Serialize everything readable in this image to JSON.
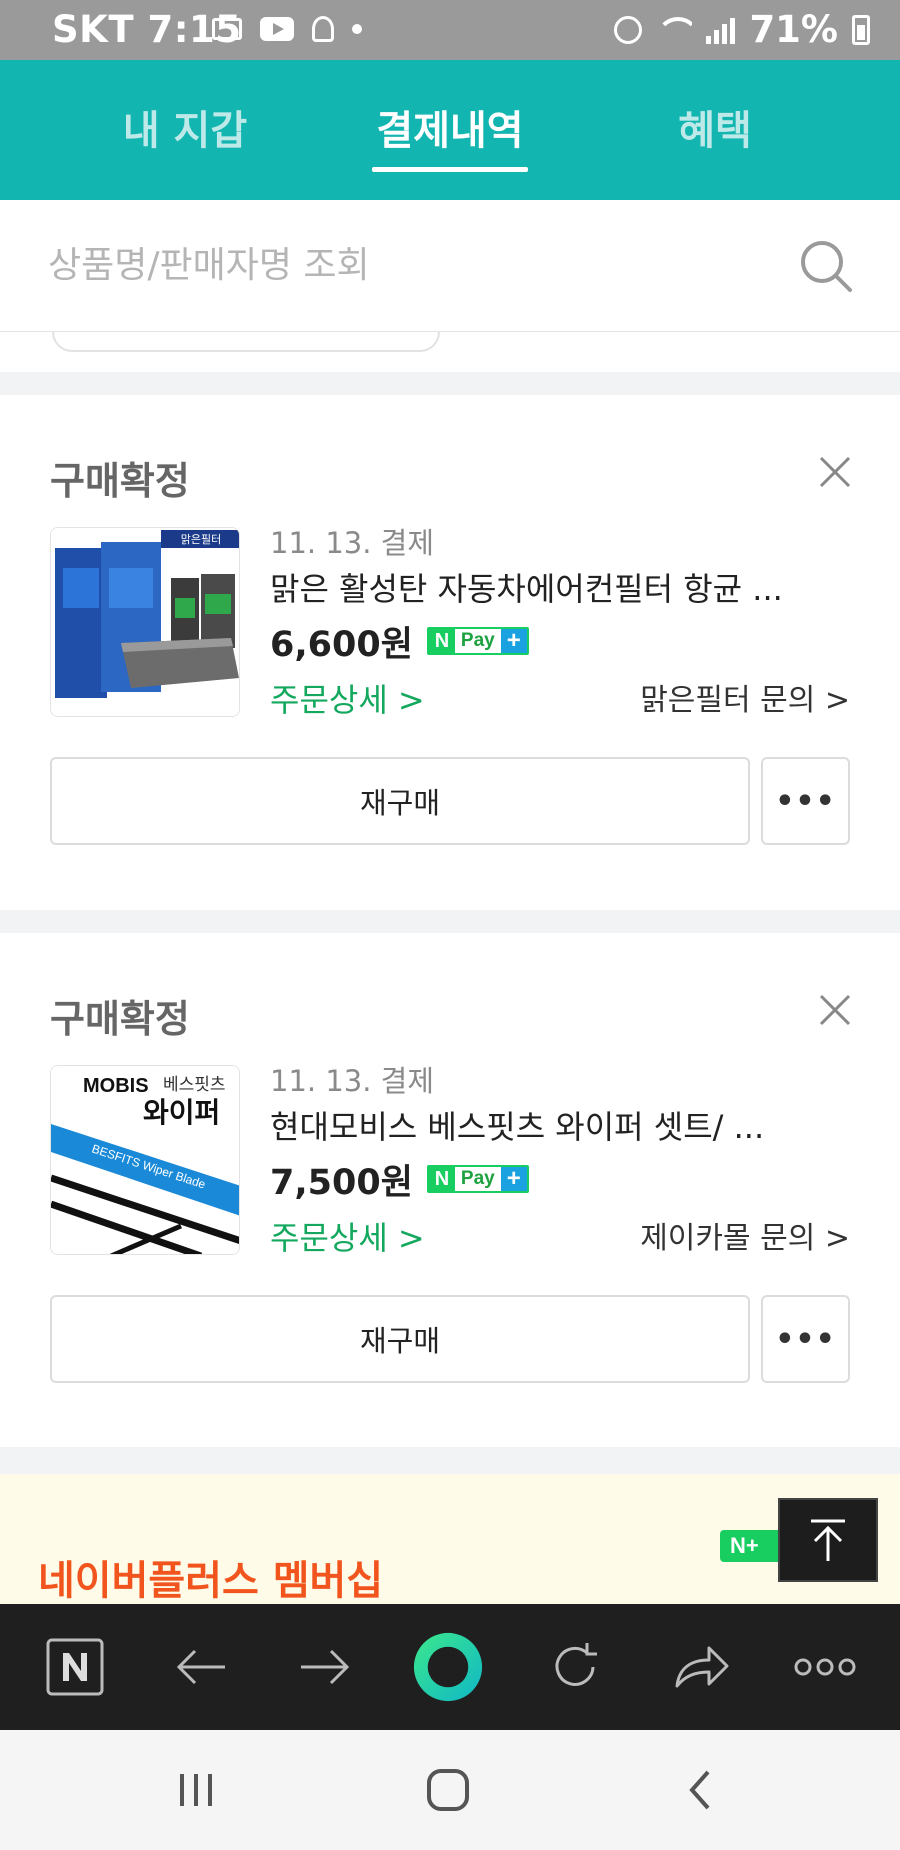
{
  "status_bar": {
    "carrier": "SKT",
    "time": "7:15",
    "battery": "71%",
    "icons_left": [
      "mail-icon",
      "youtube-icon",
      "figure-icon",
      "dot-icon"
    ],
    "icons_right": [
      "alarm-icon",
      "wifi-icon",
      "signal-icon",
      "battery-icon"
    ]
  },
  "tabs": [
    {
      "label": "내 지갑",
      "active": false
    },
    {
      "label": "결제내역",
      "active": true
    },
    {
      "label": "혜택",
      "active": false
    }
  ],
  "search": {
    "placeholder": "상품명/판매자명 조회",
    "value": ""
  },
  "orders": [
    {
      "status": "구매확정",
      "pay_date": "11. 13. 결제",
      "title": "맑은 활성탄 자동차에어컨필터 항균 ...",
      "price": "6,600원",
      "npay": {
        "n": "N",
        "pay": "Pay",
        "plus": "+"
      },
      "order_detail": "주문상세 >",
      "seller_inquiry": "맑은필터 문의 >",
      "rebuy": "재구매",
      "more": "•••",
      "thumb_text": "맑은필터"
    },
    {
      "status": "구매확정",
      "pay_date": "11. 13. 결제",
      "title": "현대모비스 베스핏츠 와이퍼 셋트/ ...",
      "price": "7,500원",
      "npay": {
        "n": "N",
        "pay": "Pay",
        "plus": "+"
      },
      "order_detail": "주문상세 >",
      "seller_inquiry": "제이카몰 문의 >",
      "rebuy": "재구매",
      "more": "•••",
      "thumb_brand": "MOBIS",
      "thumb_sub": "베스핏츠",
      "thumb_title": "와이퍼",
      "thumb_blade": "BESFITS  Wiper Blade"
    }
  ],
  "promo": {
    "text": "네이버플러스 멤버십",
    "badge": "N+"
  },
  "browser_toolbar": [
    "naver-home-icon",
    "back-arrow-icon",
    "forward-arrow-icon",
    "green-dot-icon",
    "refresh-icon",
    "share-icon",
    "more-dots-icon"
  ],
  "system_nav": [
    "recents-icon",
    "home-icon",
    "back-icon"
  ],
  "colors": {
    "accent": "#12b5b0",
    "green_link": "#13a85e",
    "promo_orange": "#f1551d",
    "npay_green": "#19ce60"
  }
}
